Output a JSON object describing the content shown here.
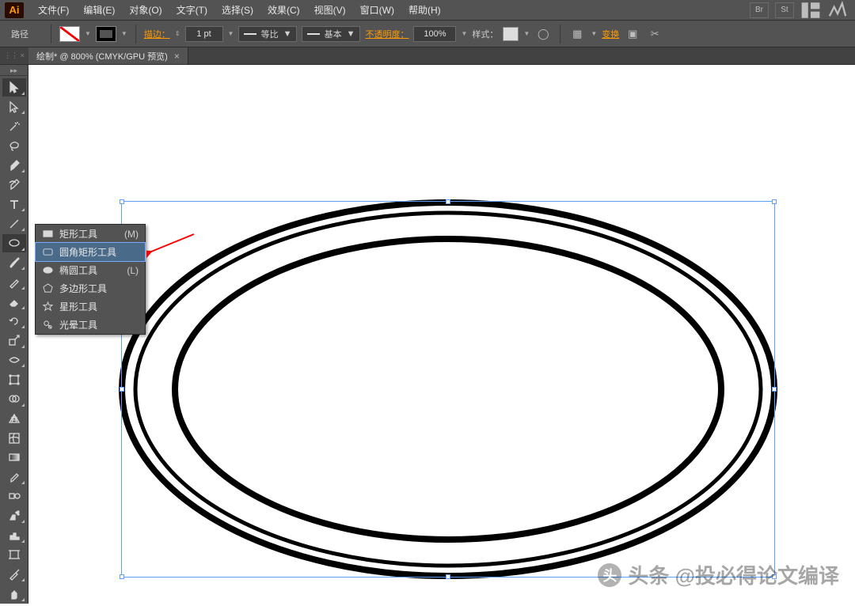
{
  "app": {
    "logo": "Ai"
  },
  "menu": {
    "items": [
      "文件(F)",
      "编辑(E)",
      "对象(O)",
      "文字(T)",
      "选择(S)",
      "效果(C)",
      "视图(V)",
      "窗口(W)",
      "帮助(H)"
    ],
    "right_boxes": [
      "Br",
      "St"
    ]
  },
  "control": {
    "selection_label": "路径",
    "stroke_label": "描边：",
    "stroke_value": "1 pt",
    "profile_label": "等比",
    "brush_label": "基本",
    "opacity_label": "不透明度：",
    "opacity_value": "100%",
    "style_label": "样式：",
    "transform_link": "变换"
  },
  "tab": {
    "title": "绘制* @ 800% (CMYK/GPU 预览)"
  },
  "flyout": {
    "items": [
      {
        "label": "矩形工具",
        "shortcut": "(M)",
        "icon": "rect"
      },
      {
        "label": "圆角矩形工具",
        "shortcut": "",
        "icon": "rrect",
        "selected": true
      },
      {
        "label": "椭圆工具",
        "shortcut": "(L)",
        "icon": "ellipse"
      },
      {
        "label": "多边形工具",
        "shortcut": "",
        "icon": "polygon"
      },
      {
        "label": "星形工具",
        "shortcut": "",
        "icon": "star"
      },
      {
        "label": "光晕工具",
        "shortcut": "",
        "icon": "flare"
      }
    ]
  },
  "watermark": {
    "text": "头条 @投必得论文编译"
  }
}
